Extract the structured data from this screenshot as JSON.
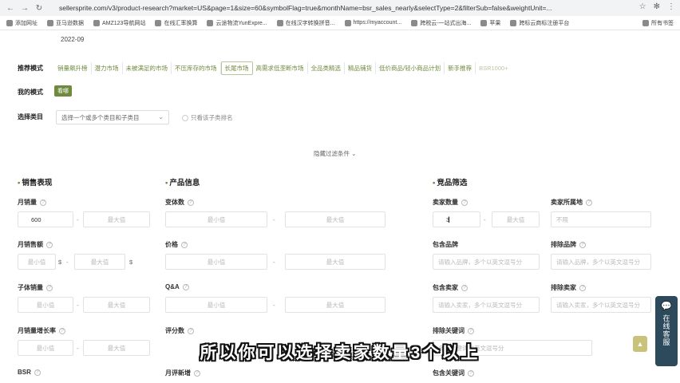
{
  "browser": {
    "url": "sellersprite.com/v3/product-research?market=US&page=1&size=60&symbolFlag=true&monthName=bsr_sales_nearly&selectType=2&filterSub=false&weightUnit=...",
    "bookmarks": [
      "添加网址",
      "亚马逊数据",
      "AMZ123导航网站",
      "在线汇率换算",
      "云途物流YunExpre...",
      "在线汉字转换拼音...",
      "https://myaccount...",
      "跨税云-一站式出海...",
      "苹果",
      "跨标云商标注册平台"
    ],
    "all_bookmarks": "所有书签",
    "icons": {
      "back": "←",
      "forward": "→",
      "reload": "↻"
    }
  },
  "page": {
    "date_chip": "2022-09",
    "recommend_mode_label": "推荐模式",
    "recommend_tags": [
      "销量飙升榜",
      "潜力市场",
      "未被满足的市场",
      "不压库存的市场",
      "长尾市场",
      "高需求低垄断市场",
      "全品类精选",
      "精品铺货",
      "低价商品/轻小商品计划",
      "新手推荐",
      "BSR1000+"
    ],
    "recommend_selected": "长尾市场",
    "my_mode_label": "我的模式",
    "my_mode_chip": "看哪",
    "category_label": "选择类目",
    "category_placeholder": "选择一个或多个类目和子类目",
    "only_subcat": "只看该子类排名",
    "collapse_filters": "隐藏过滤条件"
  },
  "sections": {
    "sales": "销售表现",
    "product": "产品信息",
    "competition": "竞品筛选"
  },
  "fields": {
    "monthly_sales": "月销量",
    "monthly_sales_min": "600",
    "monthly_revenue": "月销售额",
    "sub_sales": "子体销量",
    "sales_growth": "月销量增长率",
    "bsr": "BSR",
    "variants": "变体数",
    "price": "价格",
    "qa": "Q&A",
    "reviews": "评分数",
    "monthly_new_reviews": "月评新增",
    "seller_count": "卖家数量",
    "seller_count_min": "3",
    "seller_location": "卖家所属地",
    "include_brand": "包含品牌",
    "exclude_brand": "排除品牌",
    "include_seller": "包含卖家",
    "exclude_seller": "排除卖家",
    "exclude_keywords": "排除关键词",
    "include_keywords": "包含关键词",
    "ph_min": "最小值",
    "ph_max": "最大值",
    "ph_brand": "请输入品牌，多个以英文逗号分",
    "ph_brand2": "请输入品牌，多个以英文逗号分",
    "ph_seller": "请输入卖家，多个以英文逗号分",
    "ph_seller2": "请输入卖家，多个以英文逗号分",
    "ph_any": "不限",
    "ph_keywords": "多个关键词以英文逗号分",
    "dollar": "$"
  },
  "widget": {
    "online_service": "在线客服",
    "top": "▲"
  },
  "subtitle": "所以你可以选择卖家数量3个以上"
}
